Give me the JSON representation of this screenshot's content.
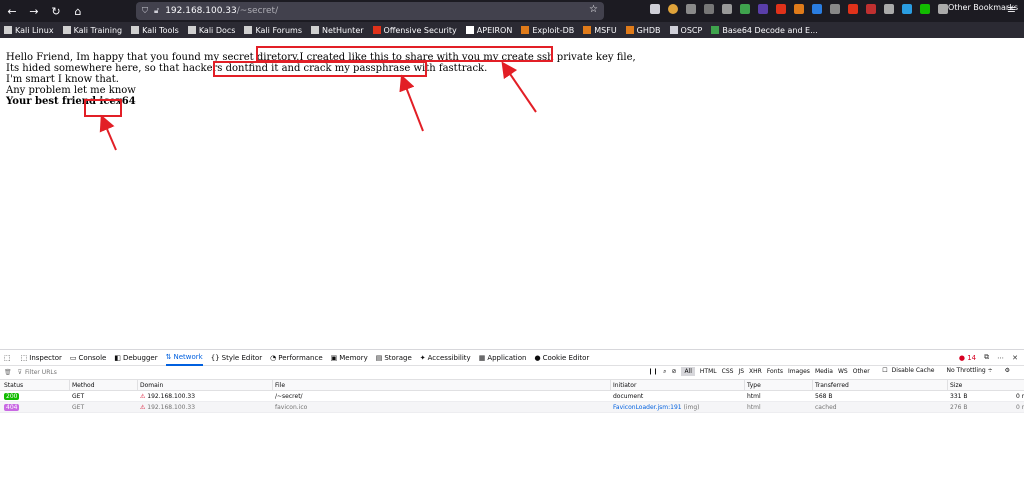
{
  "browser": {
    "url_host": "192.168.100.33",
    "url_path": "/~secret/",
    "bookmarks": [
      {
        "label": "Kali Linux",
        "color": "#d0d0d0"
      },
      {
        "label": "Kali Training",
        "color": "#d0d0d0"
      },
      {
        "label": "Kali Tools",
        "color": "#d0d0d0"
      },
      {
        "label": "Kali Docs",
        "color": "#d0d0d0"
      },
      {
        "label": "Kali Forums",
        "color": "#d0d0d0"
      },
      {
        "label": "NetHunter",
        "color": "#d0d0d0"
      },
      {
        "label": "Offensive Security",
        "color": "#e0321a"
      },
      {
        "label": "APEIRON",
        "color": "#ffffff"
      },
      {
        "label": "Exploit-DB",
        "color": "#e07b1a"
      },
      {
        "label": "MSFU",
        "color": "#e07b1a"
      },
      {
        "label": "GHDB",
        "color": "#e07b1a"
      },
      {
        "label": "OSCP",
        "color": "#cfcfd8"
      },
      {
        "label": "Base64 Decode and E...",
        "color": "#3fa34d"
      }
    ],
    "other_bookmarks": "Other Bookmarks"
  },
  "page": {
    "line1_pre": "Hello Friend, Im happy that you found my secret diretory.",
    "line1_hl": "I created like this to share with you my create ssh private key file,",
    "line2_pre": "Its hided somewhere here, so that hackers dont",
    "line2_hl": "find it and crack my passphrase with fasttrack.",
    "line3": "I'm smart I know that.",
    "line4": "Any problem let me know",
    "bold_pre": "Your best friend ",
    "bold_hl": "icex64"
  },
  "devtools": {
    "tabs": [
      {
        "label": "Inspector",
        "icon": "inspector-icon"
      },
      {
        "label": "Console",
        "icon": "console-icon"
      },
      {
        "label": "Debugger",
        "icon": "debugger-icon"
      },
      {
        "label": "Network",
        "icon": "network-icon",
        "active": true
      },
      {
        "label": "Style Editor",
        "icon": "braces-icon"
      },
      {
        "label": "Performance",
        "icon": "performance-icon"
      },
      {
        "label": "Memory",
        "icon": "memory-icon"
      },
      {
        "label": "Storage",
        "icon": "storage-icon"
      },
      {
        "label": "Accessibility",
        "icon": "accessibility-icon"
      },
      {
        "label": "Application",
        "icon": "application-icon"
      },
      {
        "label": "Cookie Editor",
        "icon": "cookie-icon"
      }
    ],
    "error_count": "14",
    "filter_placeholder": "Filter URLs",
    "filter_types": [
      "All",
      "HTML",
      "CSS",
      "JS",
      "XHR",
      "Fonts",
      "Images",
      "Media",
      "WS",
      "Other"
    ],
    "disable_cache": "Disable Cache",
    "throttling": "No Throttling ÷",
    "columns": [
      "Status",
      "Method",
      "Domain",
      "File",
      "Initiator",
      "Type",
      "Transferred",
      "Size"
    ],
    "rows": [
      {
        "status": "200",
        "status_color": "#12bc00",
        "method": "GET",
        "domain": "192.168.100.33",
        "file": "/~secret/",
        "initiator": "document",
        "type": "html",
        "transferred": "568 B",
        "size": "331 B",
        "last": "0 m"
      },
      {
        "status": "404",
        "status_color": "#c969e3",
        "method": "GET",
        "domain": "192.168.100.33",
        "file": "favicon.ico",
        "initiator": "FaviconLoader.jsm:191",
        "initiator_note": " (img)",
        "type": "html",
        "transferred": "cached",
        "size": "276 B",
        "last": "0 m"
      }
    ]
  }
}
